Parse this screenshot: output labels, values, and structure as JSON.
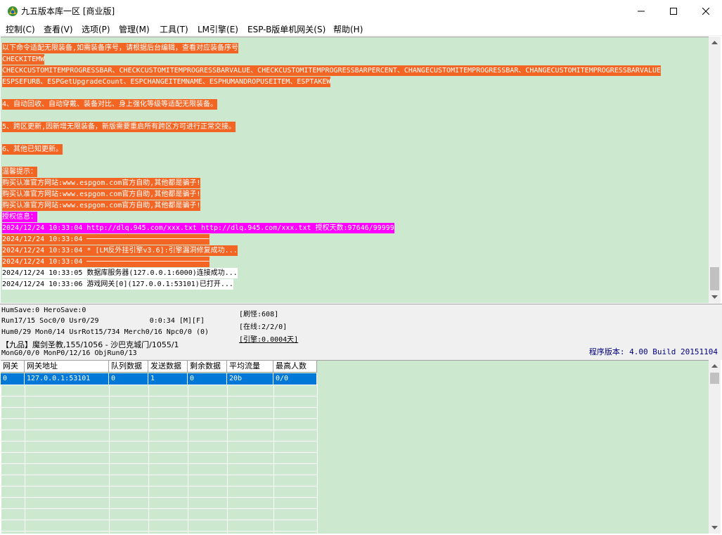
{
  "window": {
    "title": "九五版本库一区 [商业版]"
  },
  "menu": [
    "控制(C)",
    "查看(V)",
    "选项(P)",
    "管理(M)",
    "工具(T)",
    "LM引擎(E)",
    "ESP-B版单机网关(S)",
    "帮助(H)"
  ],
  "log": [
    {
      "text": "以下命令适配无限装备,如需装备序号，请根据后台编辑，查看对应装备序号",
      "style": "orange"
    },
    {
      "text": "CHECKITEMW",
      "style": "orange"
    },
    {
      "text": "CHECKCUSTOMITEMPROGRESSBAR、CHECKCUSTOMITEMPROGRESSBARVALUE、CHECKCUSTOMITEMPROGRESSBARPERCENT、CHANGECUSTOMITEMPROGRESSBAR、CHANGECUSTOMITEMPROGRESSBARVALUE",
      "style": "orange"
    },
    {
      "text": "ESPSEFURB、ESPGetUpgradeCount、ESPCHANGEITEMNAME、ESPHUMANDROPUSEITEM、ESPTAKEW",
      "style": "orange"
    },
    {
      "text": "",
      "style": "none"
    },
    {
      "text": "4、自动回收、自动穿戴、装备对比、身上强化等级等适配无限装备。",
      "style": "orange"
    },
    {
      "text": "",
      "style": "none"
    },
    {
      "text": "5、跨区更新,因新增无限装备，新版需要重启所有跨区方可进行正常交接。",
      "style": "orange"
    },
    {
      "text": "",
      "style": "none"
    },
    {
      "text": "6、其他已知更新。",
      "style": "orange"
    },
    {
      "text": "",
      "style": "none"
    },
    {
      "text": "温馨提示：",
      "style": "orange"
    },
    {
      "text": "购买认准官方网站:www.espgom.com官方自助,其他都是骗子!",
      "style": "orange"
    },
    {
      "text": "购买认准官方网站:www.espgom.com官方自助,其他都是骗子!",
      "style": "orange"
    },
    {
      "text": "购买认准官方网站:www.espgom.com官方自助,其他都是骗子!",
      "style": "orange"
    },
    {
      "text": "授权信息：",
      "style": "magenta"
    },
    {
      "text": "2024/12/24 10:33:04 http://dlq.945.com/xxx.txt http://dlq.945.com/xxx.txt 授权天数:97646/99999",
      "style": "magenta"
    },
    {
      "text": "2024/12/24 10:33:04 ─────────────────────────────",
      "style": "orange"
    },
    {
      "text": "2024/12/24 10:33:04 * [LM反外挂引擎v3.6]:引擎漏洞修复成功...",
      "style": "orange"
    },
    {
      "text": "2024/12/24 10:33:04 ─────────────────────────────",
      "style": "orange"
    },
    {
      "text": "2024/12/24 10:33:05 数据库服务器(127.0.0.1:6000)连接成功...",
      "style": "plain"
    },
    {
      "text": "2024/12/24 10:33:06 游戏网关[0](127.0.0.1:53101)已打开...",
      "style": "plain"
    }
  ],
  "status": {
    "line1": "HumSave:0 HeroSave:0",
    "line2": "Run17/15 Soc0/0 Usr0/29            0:0:34 [M][F]",
    "line3": "Hum0/29 Mon0/14 UsrRot15/734 Merch0/16 Npc0/0 (0)",
    "line4": "【九品】魔剑圣教,155/1056 - 沙巴克城门/1055/1",
    "line5": "MonG0/0/0 MonP0/12/16 ObjRun0/13",
    "box1": "[刷怪:608]",
    "box2": "[在线:2/2/0]",
    "box3": "[引擎:0.0004天]",
    "version": "程序版本: 4.00 Build 20151104"
  },
  "table": {
    "headers": [
      "网关",
      "网关地址",
      "队列数据",
      "发送数据",
      "剩余数据",
      "平均流量",
      "最高人数"
    ],
    "rows": [
      [
        "0",
        "127.0.0.1:53101",
        "0",
        "1",
        "0",
        "20b",
        "0/0"
      ]
    ]
  }
}
